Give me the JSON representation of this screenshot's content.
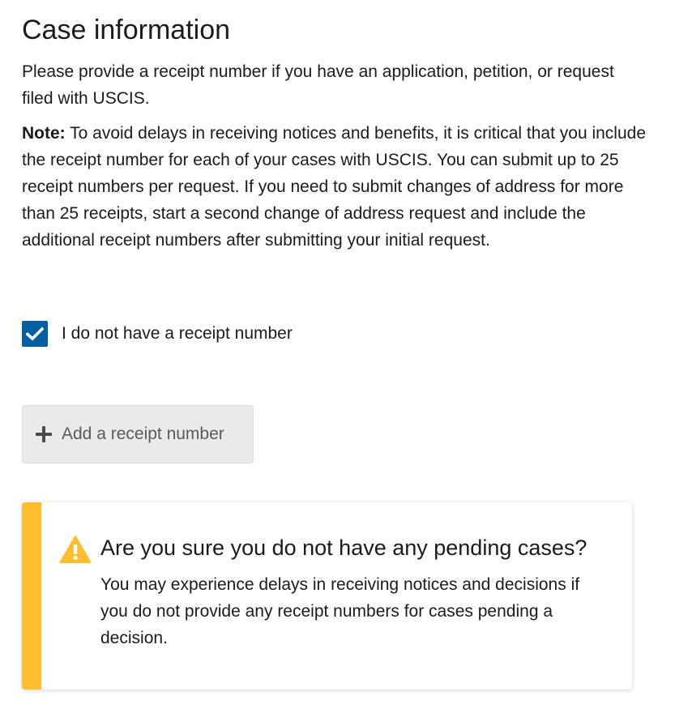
{
  "section": {
    "title": "Case information",
    "intro": "Please provide a receipt number if you have an application, petition, or request filed with USCIS.",
    "note_label": "Note:",
    "note_text": " To avoid delays in receiving notices and benefits, it is critical that you include the receipt number for each of your cases with USCIS. You can submit up to 25 receipt numbers per request. If you need to submit changes of address for more than 25 receipts, start a second change of address request and include the additional receipt numbers after submitting your initial request."
  },
  "checkbox": {
    "label": "I do not have a receipt number",
    "checked": true,
    "color": "#005ea2"
  },
  "add_button": {
    "label": "Add a receipt number",
    "icon": "plus-icon",
    "disabled": true
  },
  "alert": {
    "type": "warning",
    "accent_color": "#ffbe2e",
    "icon": "warning-icon",
    "heading": "Are you sure you do not have any pending cases?",
    "body": "You may experience delays in receiving notices and decisions if you do not provide any receipt numbers for cases pending a decision."
  }
}
